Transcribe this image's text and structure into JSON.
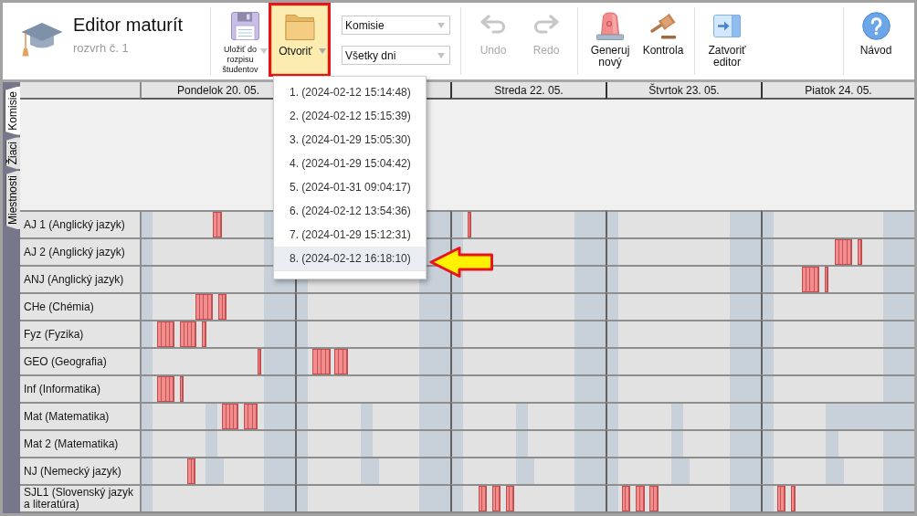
{
  "app": {
    "title": "Editor maturít",
    "subtitle": "rozvrh č. 1"
  },
  "toolbar": {
    "groups": [
      {
        "buttons": [
          {
            "kind": "split",
            "label": "Uložiť do rozpisu študentov",
            "disabled": false,
            "active": false,
            "marked": false
          },
          {
            "kind": "menu",
            "label": "Otvoriť",
            "disabled": false,
            "active": true,
            "marked": true,
            "menu": {
              "items": [
                {
                  "label": "1. (2024-02-12 15:14:48)",
                  "selected": false,
                  "marked": false
                },
                {
                  "label": "2. (2024-02-12 15:15:39)",
                  "selected": false,
                  "marked": false
                },
                {
                  "label": "3. (2024-01-29 15:05:30)",
                  "selected": false,
                  "marked": false
                },
                {
                  "label": "4. (2024-01-29 15:04:42)",
                  "selected": false,
                  "marked": false
                },
                {
                  "label": "5. (2024-01-31 09:04:17)",
                  "selected": false,
                  "marked": false
                },
                {
                  "label": "6. (2024-02-12 13:54:36)",
                  "selected": false,
                  "marked": false
                },
                {
                  "label": "7. (2024-01-29 15:12:31)",
                  "selected": false,
                  "marked": false
                },
                {
                  "label": "8. (2024-02-12 16:18:10)",
                  "selected": true,
                  "marked": true
                }
              ]
            }
          }
        ],
        "selects": [
          {
            "value": "Komisie"
          },
          {
            "value": "Všetky dni"
          }
        ]
      },
      {
        "buttons": [
          {
            "kind": "plain",
            "label": "Undo",
            "disabled": true,
            "active": false,
            "marked": false
          },
          {
            "kind": "plain",
            "label": "Redo",
            "disabled": true,
            "active": false,
            "marked": false
          }
        ]
      },
      {
        "buttons": [
          {
            "kind": "plain",
            "label": "Generuj nový",
            "disabled": false,
            "active": false,
            "marked": false
          },
          {
            "kind": "plain",
            "label": "Kontrola",
            "disabled": false,
            "active": false,
            "marked": false
          }
        ]
      },
      {
        "buttons": [
          {
            "kind": "plain",
            "label": "Zatvoriť editor",
            "disabled": false,
            "active": false,
            "marked": false
          }
        ]
      },
      {
        "buttons": [
          {
            "kind": "plain",
            "label": "Návod",
            "disabled": false,
            "active": false,
            "marked": false
          }
        ]
      }
    ]
  },
  "side_tabs": [
    {
      "label": "Komisie",
      "selected": true
    },
    {
      "label": "Žiaci",
      "selected": false
    },
    {
      "label": "Miestnosti",
      "selected": false
    }
  ],
  "schedule": {
    "days": [
      {
        "kind": "date",
        "label": "Pondelok 20. 05."
      },
      {
        "kind": "covered"
      },
      {
        "kind": "date",
        "label": "Streda 22. 05."
      },
      {
        "kind": "date",
        "label": "Štvrtok 23. 05."
      },
      {
        "kind": "date",
        "label": "Piatok 24. 05."
      }
    ],
    "rows": [
      {
        "label": "AJ 1 (Anglický jazyk)"
      },
      {
        "label": "AJ 2 (Anglický jazyk)"
      },
      {
        "label": "ANJ (Anglický jazyk)"
      },
      {
        "label": "CHe (Chémia)"
      },
      {
        "label": "Fyz (Fyzika)"
      },
      {
        "label": "GEO (Geografia)"
      },
      {
        "label": "Inf (Informatika)"
      },
      {
        "label": "Mat (Matematika)"
      },
      {
        "label": "Mat 2 (Matematika)"
      },
      {
        "label": "NJ (Nemecký jazyk)"
      },
      {
        "label": "SJL1 (Slovenský jazyk a literatúra)"
      }
    ]
  }
}
